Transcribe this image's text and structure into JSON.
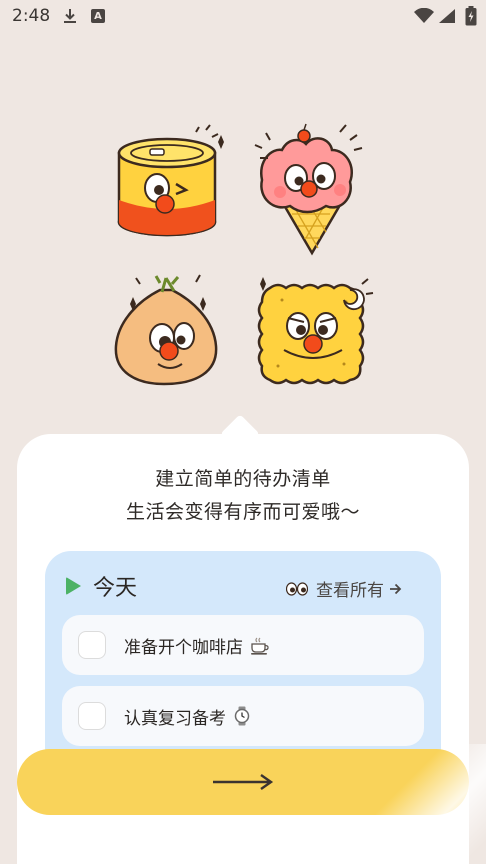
{
  "status_bar": {
    "time": "2:48",
    "icons": [
      "download-icon",
      "a-badge-icon",
      "wifi-icon",
      "signal-icon",
      "battery-icon"
    ]
  },
  "illustrations": [
    "canned-food-character",
    "ice-cream-character",
    "onion-character",
    "cracker-character"
  ],
  "intro": {
    "line1": "建立简单的待办清单",
    "line2": "生活会变得有序而可爱哦～"
  },
  "today_card": {
    "title": "今天",
    "view_all": "查看所有",
    "tasks": [
      {
        "text": "准备开个咖啡店",
        "icon": "coffee-icon",
        "checked": false
      },
      {
        "text": "认真复习备考",
        "icon": "watch-icon",
        "checked": false
      }
    ]
  },
  "next_button": {
    "icon": "long-arrow-right-icon"
  },
  "colors": {
    "background": "#efe7e2",
    "card": "#d4e8fb",
    "button": "#f9d35a",
    "play": "#4cb265"
  }
}
